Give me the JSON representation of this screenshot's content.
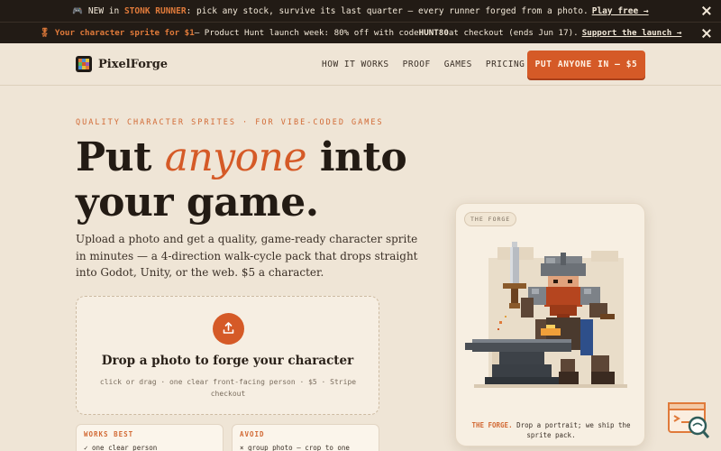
{
  "announcement1": {
    "prefix": "🎮 NEW in",
    "highlight": "STONK RUNNER",
    "text": ": pick any stock, survive its last quarter — every runner forged from a photo.",
    "link": "Play free →"
  },
  "announcement2": {
    "highlight": "🎖 Your character sprite for $1",
    "text_before": " — Product Hunt launch week: 80% off with code ",
    "code": "HUNT80",
    "text_after": " at checkout (ends Jun 17).",
    "link": "Support the launch →"
  },
  "nav": {
    "brand": "PixelForge",
    "links": [
      "HOW IT WORKS",
      "PROOF",
      "GAMES",
      "PRICING"
    ],
    "cta": "PUT ANYONE IN — $5"
  },
  "hero": {
    "eyebrow": "QUALITY CHARACTER SPRITES · FOR VIBE-CODED GAMES",
    "headline_start": "Put ",
    "headline_em": "anyone",
    "headline_mid": " into",
    "headline_end": "your game.",
    "subtitle": "Upload a photo and get a quality, game-ready character sprite in minutes — a 4-direction walk-cycle pack that drops straight into Godot, Unity, or the web. $5 a character."
  },
  "dropzone": {
    "title": "Drop a photo to forge your character",
    "hint": "click or drag · one clear front-facing person · $5 · Stripe checkout"
  },
  "tips": {
    "works_best": {
      "heading": "WORKS BEST",
      "item": "✓ one clear person"
    },
    "avoid": {
      "heading": "AVOID",
      "item": "× group photo — crop to one"
    }
  },
  "forge_card": {
    "tag": "THE FORGE",
    "caption_strong": "THE FORGE.",
    "caption": " Drop a portrait; we ship the sprite pack."
  },
  "colors": {
    "accent": "#d55a27",
    "dark_bar": "#221b15",
    "background": "#efe5d6"
  }
}
